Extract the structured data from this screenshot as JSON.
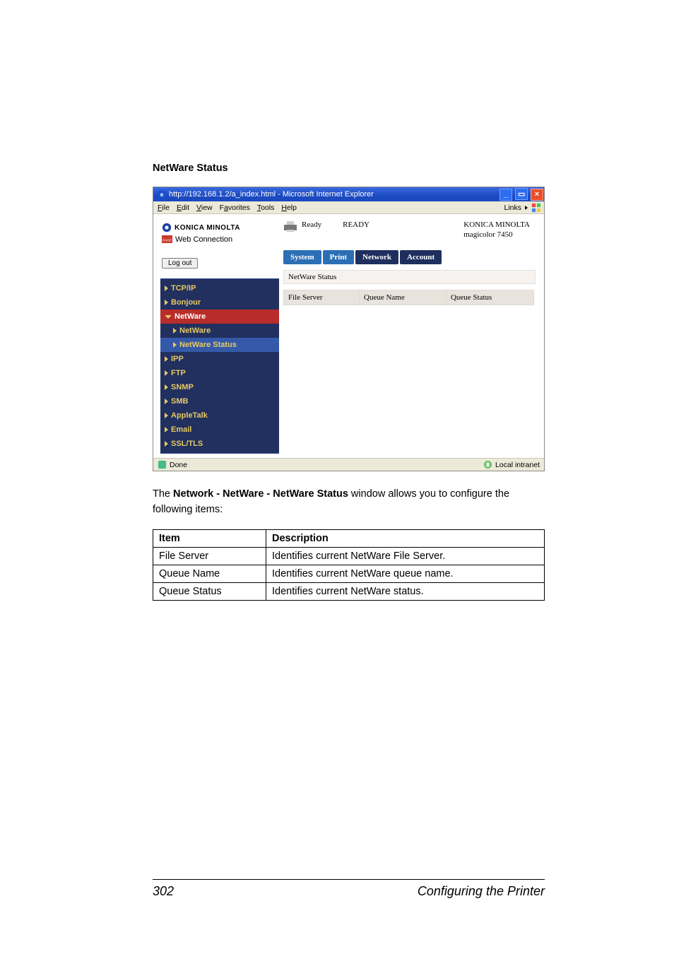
{
  "section_heading": "NetWare Status",
  "browser": {
    "title": "http://192.168.1.2/a_index.html - Microsoft Internet Explorer",
    "menu": {
      "file": "File",
      "edit": "Edit",
      "view": "View",
      "favorites": "Favorites",
      "tools": "Tools",
      "help": "Help",
      "links": "Links"
    },
    "status": {
      "done": "Done",
      "zone": "Local intranet"
    }
  },
  "brand": {
    "name": "KONICA MINOLTA",
    "web_conn": "Web Connection",
    "page_scope": "PageScope"
  },
  "logout_label": "Log out",
  "ready": {
    "label": "Ready",
    "state": "READY"
  },
  "device": {
    "maker": "KONICA MINOLTA",
    "model": "magicolor 7450"
  },
  "tabs": {
    "system": "System",
    "print": "Print",
    "network": "Network",
    "account": "Account"
  },
  "nav": {
    "tcpip": "TCP/IP",
    "bonjour": "Bonjour",
    "netware_parent": "NetWare",
    "netware_child": "NetWare",
    "netware_status": "NetWare Status",
    "ipp": "IPP",
    "ftp": "FTP",
    "snmp": "SNMP",
    "smb": "SMB",
    "appletalk": "AppleTalk",
    "email": "Email",
    "ssl": "SSL/TLS"
  },
  "panel": {
    "title": "NetWare Status",
    "cols": {
      "file_server": "File Server",
      "queue_name": "Queue Name",
      "queue_status": "Queue Status"
    }
  },
  "intro": {
    "pre": "The ",
    "bold": "Network - NetWare - NetWare Status",
    "post": " window allows you to configure the following items:"
  },
  "table_head": {
    "item": "Item",
    "desc": "Description"
  },
  "table_rows": [
    {
      "item": "File Server",
      "desc": "Identifies current NetWare File Server."
    },
    {
      "item": "Queue Name",
      "desc": "Identifies current NetWare queue name."
    },
    {
      "item": "Queue Status",
      "desc": "Identifies current NetWare status."
    }
  ],
  "footer": {
    "page": "302",
    "chapter": "Configuring the Printer"
  }
}
